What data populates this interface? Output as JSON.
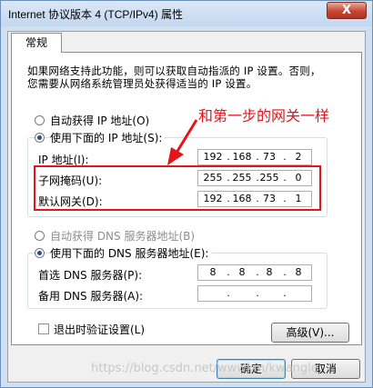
{
  "window": {
    "title": "Internet 协议版本 4 (TCP/IPv4) 属性",
    "close_label": "X"
  },
  "tab": {
    "label": "常规"
  },
  "description": [
    "如果网络支持此功能，则可以获取自动指派的 IP 设置。否则，",
    "您需要从网络系统管理员处获得适当的 IP 设置。"
  ],
  "ip_mode": {
    "auto_label": "自动获得 IP 地址(O)",
    "manual_label": "使用下面的 IP 地址(S):",
    "selected": "manual"
  },
  "ip_fields": {
    "ip": {
      "label": "IP 地址(I):",
      "octets": [
        "192",
        "168",
        "73",
        "2"
      ]
    },
    "subnet": {
      "label": "子网掩码(U):",
      "octets": [
        "255",
        "255",
        "255",
        "0"
      ]
    },
    "gateway": {
      "label": "默认网关(D):",
      "octets": [
        "192",
        "168",
        "73",
        "1"
      ]
    }
  },
  "dns_mode": {
    "auto_label": "自动获得 DNS 服务器地址(B)",
    "manual_label": "使用下面的 DNS 服务器地址(E):",
    "selected": "manual"
  },
  "dns_fields": {
    "preferred": {
      "label": "首选 DNS 服务器(P):",
      "octets": [
        "8",
        "8",
        "8",
        "8"
      ]
    },
    "alternate": {
      "label": "备用 DNS 服务器(A):",
      "octets": [
        "",
        "",
        "",
        ""
      ]
    }
  },
  "validate_on_exit": {
    "label": "退出时验证设置(L)",
    "checked": false
  },
  "buttons": {
    "advanced": "高级(V)...",
    "ok": "确定",
    "cancel": "取消"
  },
  "annotation": {
    "text": "和第一步的网关一样",
    "color": "#e3141a"
  },
  "watermark": "https://blog.csdn.net/wwwkm/kwangle"
}
